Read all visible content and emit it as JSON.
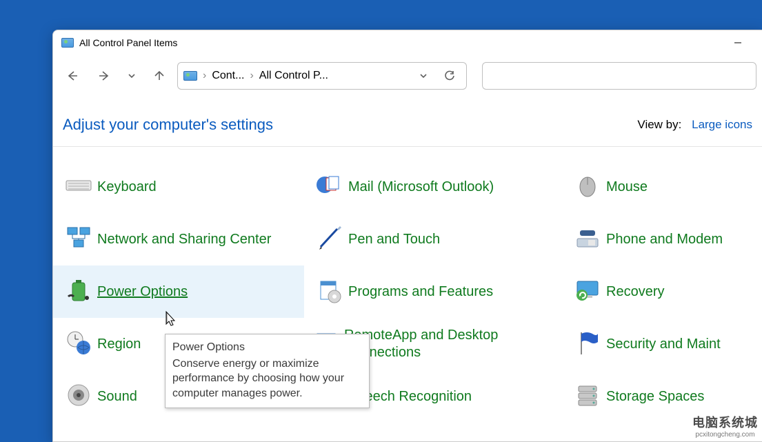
{
  "title": "All Control Panel Items",
  "breadcrumb": {
    "crumb1": "Cont...",
    "crumb2": "All Control P..."
  },
  "header": {
    "heading": "Adjust your computer's settings",
    "viewby_label": "View by:",
    "viewby_value": "Large icons"
  },
  "items": {
    "keyboard": "Keyboard",
    "mail": "Mail (Microsoft Outlook)",
    "mouse": "Mouse",
    "network": "Network and Sharing Center",
    "pen": "Pen and Touch",
    "phone": "Phone and Modem",
    "power": "Power Options",
    "programs": "Programs and Features",
    "recovery": "Recovery",
    "region": "Region",
    "remoteapp": "RemoteApp and Desktop Connections",
    "security": "Security and Maint",
    "sound": "Sound",
    "speech": "Speech Recognition",
    "storage": "Storage Spaces"
  },
  "tooltip": {
    "title": "Power Options",
    "body": "Conserve energy or maximize performance by choosing how your computer manages power."
  },
  "watermark": {
    "main": "电脑系统城",
    "sub": "pcxitongcheng.com"
  }
}
